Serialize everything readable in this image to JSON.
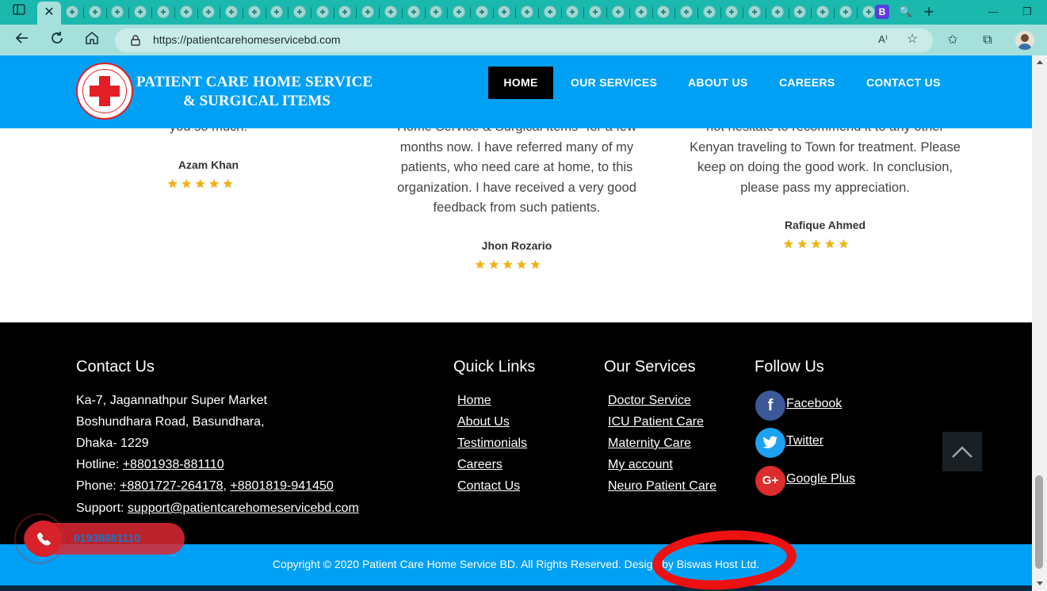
{
  "browser": {
    "active_tab_close": "✕",
    "new_tab": "+",
    "url": "https://patientcarehomeservicebd.com",
    "minimize": "—",
    "restore": "❐",
    "read_aloud": "A⁾"
  },
  "header": {
    "brand_line1": "PATIENT CARE HOME SERVICE",
    "brand_line2": "& SURGICAL ITEMS",
    "menu": {
      "home": "HOME",
      "services": "OUR SERVICES",
      "about": "ABOUT US",
      "careers": "CAREERS",
      "contact": "CONTACT US"
    }
  },
  "testimonials": [
    {
      "text_lines": [
        "you so much!"
      ],
      "name": "Azam Khan",
      "stars": "★★★★★"
    },
    {
      "text_lines": [
        "Home Service & Surgical Items\" for a few",
        "months now. I have referred many of my",
        "patients, who need care at home, to this",
        "organization. I have received a very good",
        "feedback from such patients."
      ],
      "name": "Jhon Rozario",
      "stars": "★★★★★"
    },
    {
      "text_lines": [
        "not hesitate to recommend it to any other",
        "Kenyan traveling to Town for treatment. Please",
        "keep on doing the good work. In conclusion,",
        "please pass my appreciation."
      ],
      "name": "Rafique Ahmed",
      "stars": "★★★★★"
    }
  ],
  "footer": {
    "contact": {
      "heading": "Contact Us",
      "address1": "Ka-7, Jagannathpur Super Market",
      "address2": "Boshundhara Road, Basundhara,",
      "address3": "Dhaka- 1229",
      "hotline_label": "Hotline: ",
      "hotline": "+8801938-881110",
      "phone_label": "Phone: ",
      "phone1": "+8801727-264178",
      "phone_sep": ", ",
      "phone2": "+8801819-941450",
      "support_label": "Support: ",
      "support_email": "support@patientcarehomeservicebd.com"
    },
    "quick_links": {
      "heading": "Quick Links",
      "items": [
        "Home",
        "About Us",
        "Testimonials",
        "Careers",
        "Contact Us"
      ]
    },
    "services": {
      "heading": "Our Services",
      "items": [
        "Doctor Service",
        "ICU Patient Care",
        "Maternity Care",
        "My account",
        "Neuro Patient Care"
      ]
    },
    "follow": {
      "heading": "Follow Us",
      "facebook": " Facebook",
      "twitter": " Twitter",
      "google": " Google Plus"
    },
    "copyright": "Copyright © 2020 Patient Care Home Service BD. All Rights Reserved. Design by Biswas Host Ltd."
  },
  "call_widget": {
    "number": "01938881110"
  },
  "colors": {
    "brand_blue": "#00a0f5",
    "footer_black": "#000000",
    "active_menu": "#000000",
    "annotation_red": "#ee1111",
    "star": "#f5b301"
  },
  "icons": [
    "sidebar-toggle-icon",
    "back-icon",
    "reload-icon",
    "home-icon",
    "lock-icon",
    "read-aloud-icon",
    "favorite-add-icon",
    "favorites-icon",
    "collections-icon",
    "profile-avatar",
    "facebook-icon",
    "twitter-icon",
    "google-plus-icon",
    "chevron-up-icon",
    "phone-icon"
  ]
}
